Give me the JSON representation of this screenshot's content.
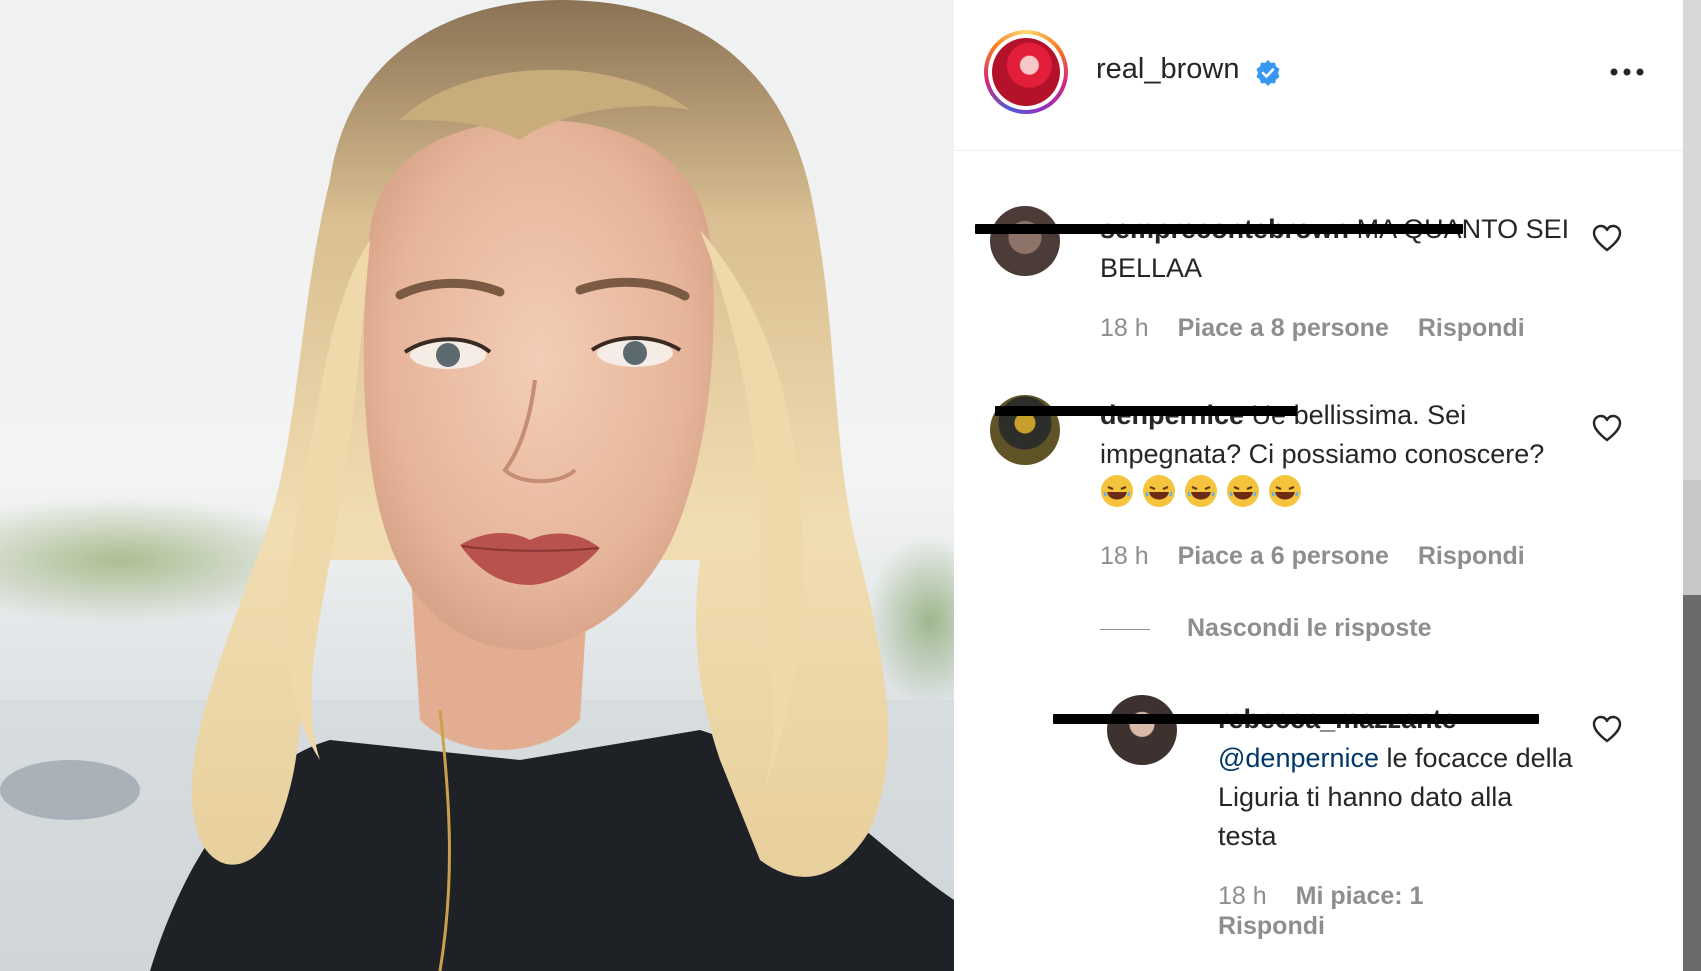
{
  "post": {
    "image_name": "selfie-photo"
  },
  "header": {
    "username": "real_brown",
    "verified": true,
    "more_icon": "more-options-icon"
  },
  "comments": [
    {
      "username": "semprecontebrown",
      "text": "MA QUANTO SEI BELLAA",
      "time": "18 h",
      "likes": "Piace a 8 persone",
      "reply": "Rispondi"
    },
    {
      "username": "denpernice",
      "text": "Ue bellissima. Sei impegnata? Ci possiamo conoscere?",
      "emoji": "😂😂😂😂😂",
      "time": "18 h",
      "likes": "Piace a 6 persone",
      "reply": "Rispondi"
    }
  ],
  "replies_toggle": "Nascondi le risposte",
  "reply": {
    "username": "rebecca_mazzante",
    "mention": "@denpernice",
    "text": "le focacce della Liguria ti hanno dato alla testa",
    "time": "18 h",
    "likes": "Mi piace: 1",
    "reply": "Rispondi"
  },
  "colors": {
    "verified_blue": "#3897f0",
    "meta_gray": "#8e8e8e",
    "mention_blue": "#00376b"
  }
}
